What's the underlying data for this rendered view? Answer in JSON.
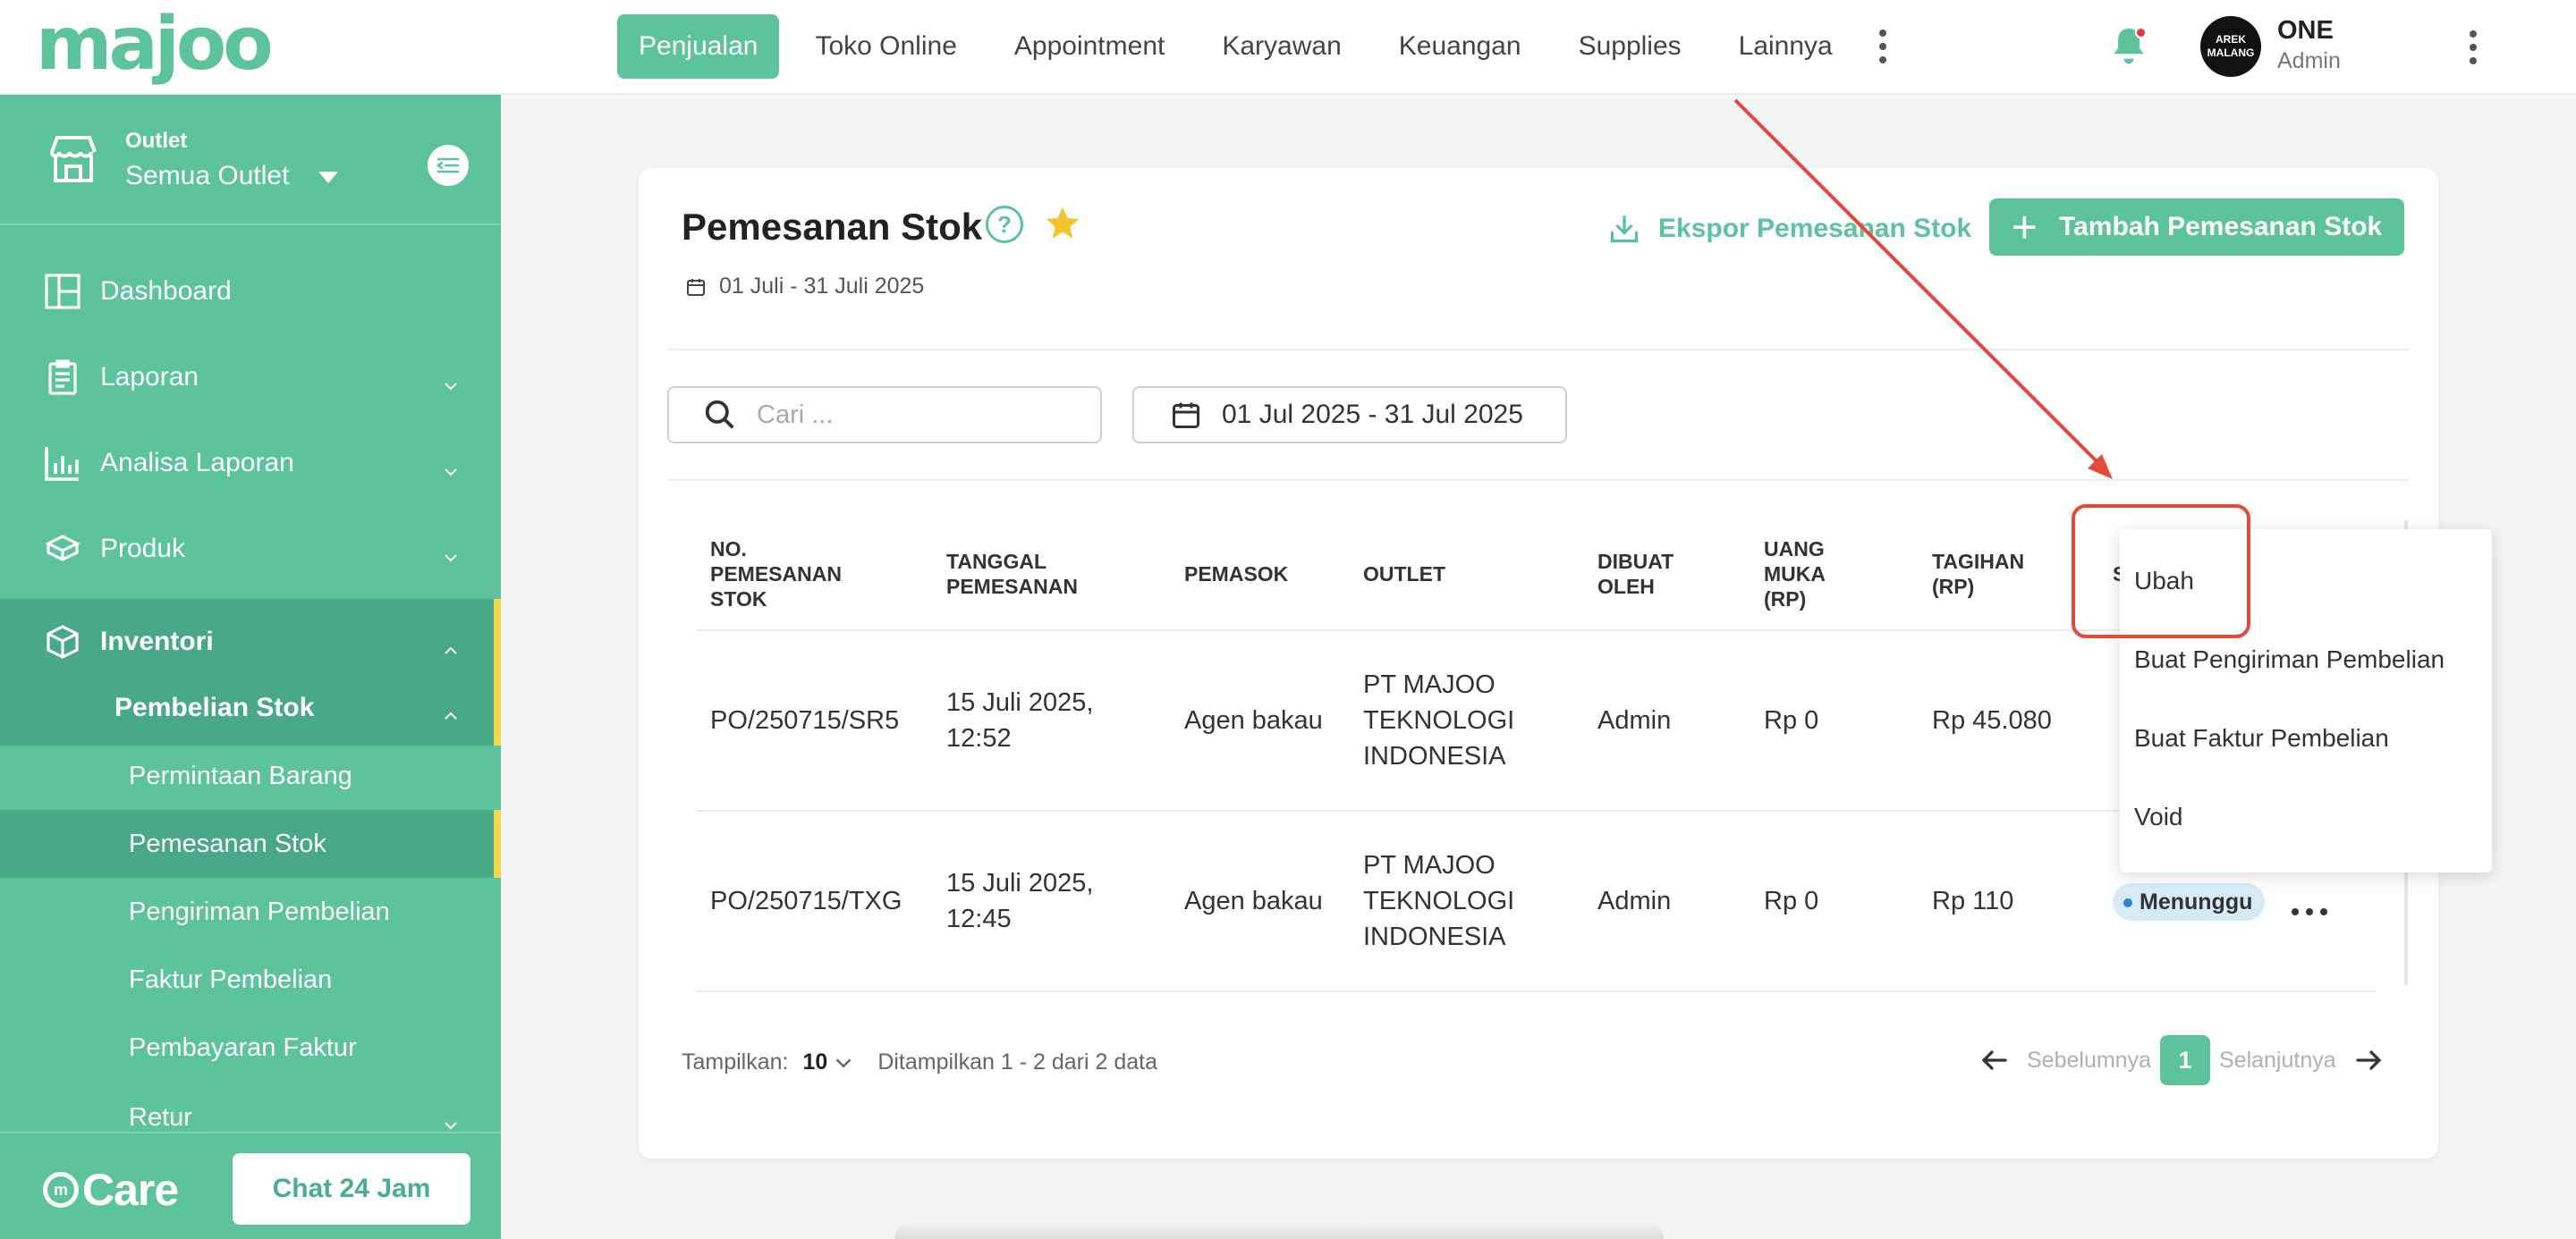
{
  "brand": {
    "logo_text": "majoo",
    "accent": "#5cc39d",
    "warn": "#f2d64b"
  },
  "topnav": {
    "items": [
      {
        "label": "Penjualan",
        "active": true
      },
      {
        "label": "Toko Online"
      },
      {
        "label": "Appointment"
      },
      {
        "label": "Karyawan"
      },
      {
        "label": "Keuangan"
      },
      {
        "label": "Supplies"
      },
      {
        "label": "Lainnya"
      }
    ]
  },
  "user": {
    "avatar_line1": "AREK",
    "avatar_line2": "MALANG",
    "name": "ONE",
    "role": "Admin"
  },
  "sidebar": {
    "outlet_label": "Outlet",
    "outlet_value": "Semua Outlet",
    "menu": [
      {
        "label": "Dashboard",
        "icon": "dashboard-icon"
      },
      {
        "label": "Laporan",
        "icon": "clipboard-icon"
      },
      {
        "label": "Analisa Laporan",
        "icon": "bar-chart-icon"
      },
      {
        "label": "Produk",
        "icon": "box-icon"
      },
      {
        "label": "Inventori",
        "icon": "cube-icon"
      }
    ],
    "pembelian_stok": "Pembelian Stok",
    "sub": [
      {
        "label": "Permintaan Barang"
      },
      {
        "label": "Pemesanan Stok",
        "active": true
      },
      {
        "label": "Pengiriman Pembelian"
      },
      {
        "label": "Faktur Pembelian"
      },
      {
        "label": "Pembayaran Faktur"
      },
      {
        "label": "Retur"
      }
    ],
    "care_label": "Care",
    "chat_label": "Chat 24 Jam"
  },
  "page": {
    "title": "Pemesanan Stok",
    "date_sub": "01 Juli - 31 Juli 2025",
    "export_label": "Ekspor Pemesanan Stok",
    "add_label": "Tambah Pemesanan Stok"
  },
  "filters": {
    "search_placeholder": "Cari ...",
    "daterange": "01 Jul 2025 - 31 Jul 2025"
  },
  "table": {
    "headers": {
      "no": [
        "NO.",
        "PEMESANAN",
        "STOK"
      ],
      "tanggal": [
        "TANGGAL",
        "PEMESANAN"
      ],
      "pemasok": [
        "PEMASOK"
      ],
      "outlet": [
        "OUTLET"
      ],
      "dibuat": [
        "DIBUAT",
        "OLEH"
      ],
      "uang_muka": [
        "UANG",
        "MUKA",
        "(RP)"
      ],
      "tagihan": [
        "TAGIHAN",
        "(RP)"
      ],
      "status_initial": "S"
    },
    "rows": [
      {
        "no": "PO/250715/SR5",
        "tanggal": [
          "15 Juli 2025,",
          "12:52"
        ],
        "pemasok": "Agen bakau",
        "outlet": [
          "PT MAJOO",
          "TEKNOLOGI",
          "INDONESIA"
        ],
        "dibuat": "Admin",
        "uang_muka": "Rp 0",
        "tagihan": "Rp 45.080",
        "status": ""
      },
      {
        "no": "PO/250715/TXG",
        "tanggal": [
          "15 Juli 2025,",
          "12:45"
        ],
        "pemasok": "Agen bakau",
        "outlet": [
          "PT MAJOO",
          "TEKNOLOGI",
          "INDONESIA"
        ],
        "dibuat": "Admin",
        "uang_muka": "Rp 0",
        "tagihan": "Rp 110",
        "status": "Menunggu"
      }
    ]
  },
  "dropdown": {
    "items": [
      "Ubah",
      "Buat Pengiriman Pembelian",
      "Buat Faktur Pembelian",
      "Void"
    ]
  },
  "pagination": {
    "show_label": "Tampilkan:",
    "page_size": "10",
    "summary": "Ditampilkan 1 - 2 dari 2 data",
    "prev": "Sebelumnya",
    "current": "1",
    "next": "Selanjutnya"
  }
}
